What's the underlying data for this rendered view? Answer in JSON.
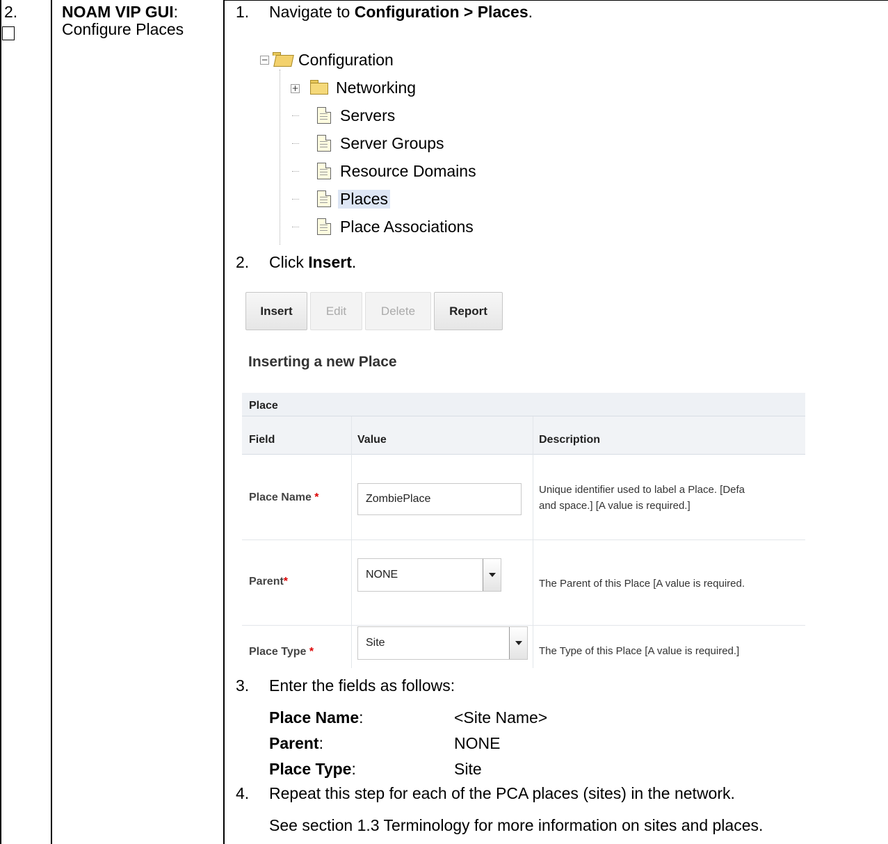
{
  "step": {
    "number": "2.",
    "title_bold": "NOAM VIP GUI",
    "title_colon": ":",
    "title_rest": "Configure Places"
  },
  "instructions": {
    "s1_num": "1.",
    "s1_pre": "Navigate to ",
    "s1_bold": "Configuration > Places",
    "s1_post": ".",
    "s2_num": "2.",
    "s2_pre": "Click ",
    "s2_bold": "Insert",
    "s2_post": ".",
    "s3_num": "3.",
    "s3_text": "Enter the fields as follows:",
    "s4_num": "4.",
    "s4_text": "Repeat this step for each of the PCA places (sites) in the network.",
    "note": "See section 1.3 Terminology for more information on sites and places."
  },
  "tree": {
    "root": "Configuration",
    "networking": "Networking",
    "servers": "Servers",
    "server_groups": "Server Groups",
    "resource_domains": "Resource Domains",
    "places": "Places",
    "place_associations": "Place Associations",
    "collapse_symbol": "−",
    "expand_symbol": "+"
  },
  "toolbar": {
    "insert": "Insert",
    "edit": "Edit",
    "delete": "Delete",
    "report": "Report"
  },
  "form": {
    "title": "Inserting a new Place",
    "section": "Place",
    "col_field": "Field",
    "col_value": "Value",
    "col_description": "Description",
    "required_mark": "*",
    "place_name_label": "Place Name",
    "place_name_value": "ZombiePlace",
    "place_name_desc_1": "Unique identifier used to label a Place. [Defa",
    "place_name_desc_2": "and space.] [A value is required.]",
    "parent_label": "Parent",
    "parent_value": "NONE",
    "parent_desc": "The Parent of this Place [A value is required.",
    "place_type_label": "Place Type",
    "place_type_value": "Site",
    "place_type_desc": "The Type of this Place [A value is required.]"
  },
  "field_values": {
    "place_name_label": "Place Name",
    "place_name_value": "<Site Name>",
    "parent_label": "Parent",
    "parent_value": "NONE",
    "place_type_label": "Place Type",
    "place_type_value": "Site",
    "colon": ":"
  }
}
